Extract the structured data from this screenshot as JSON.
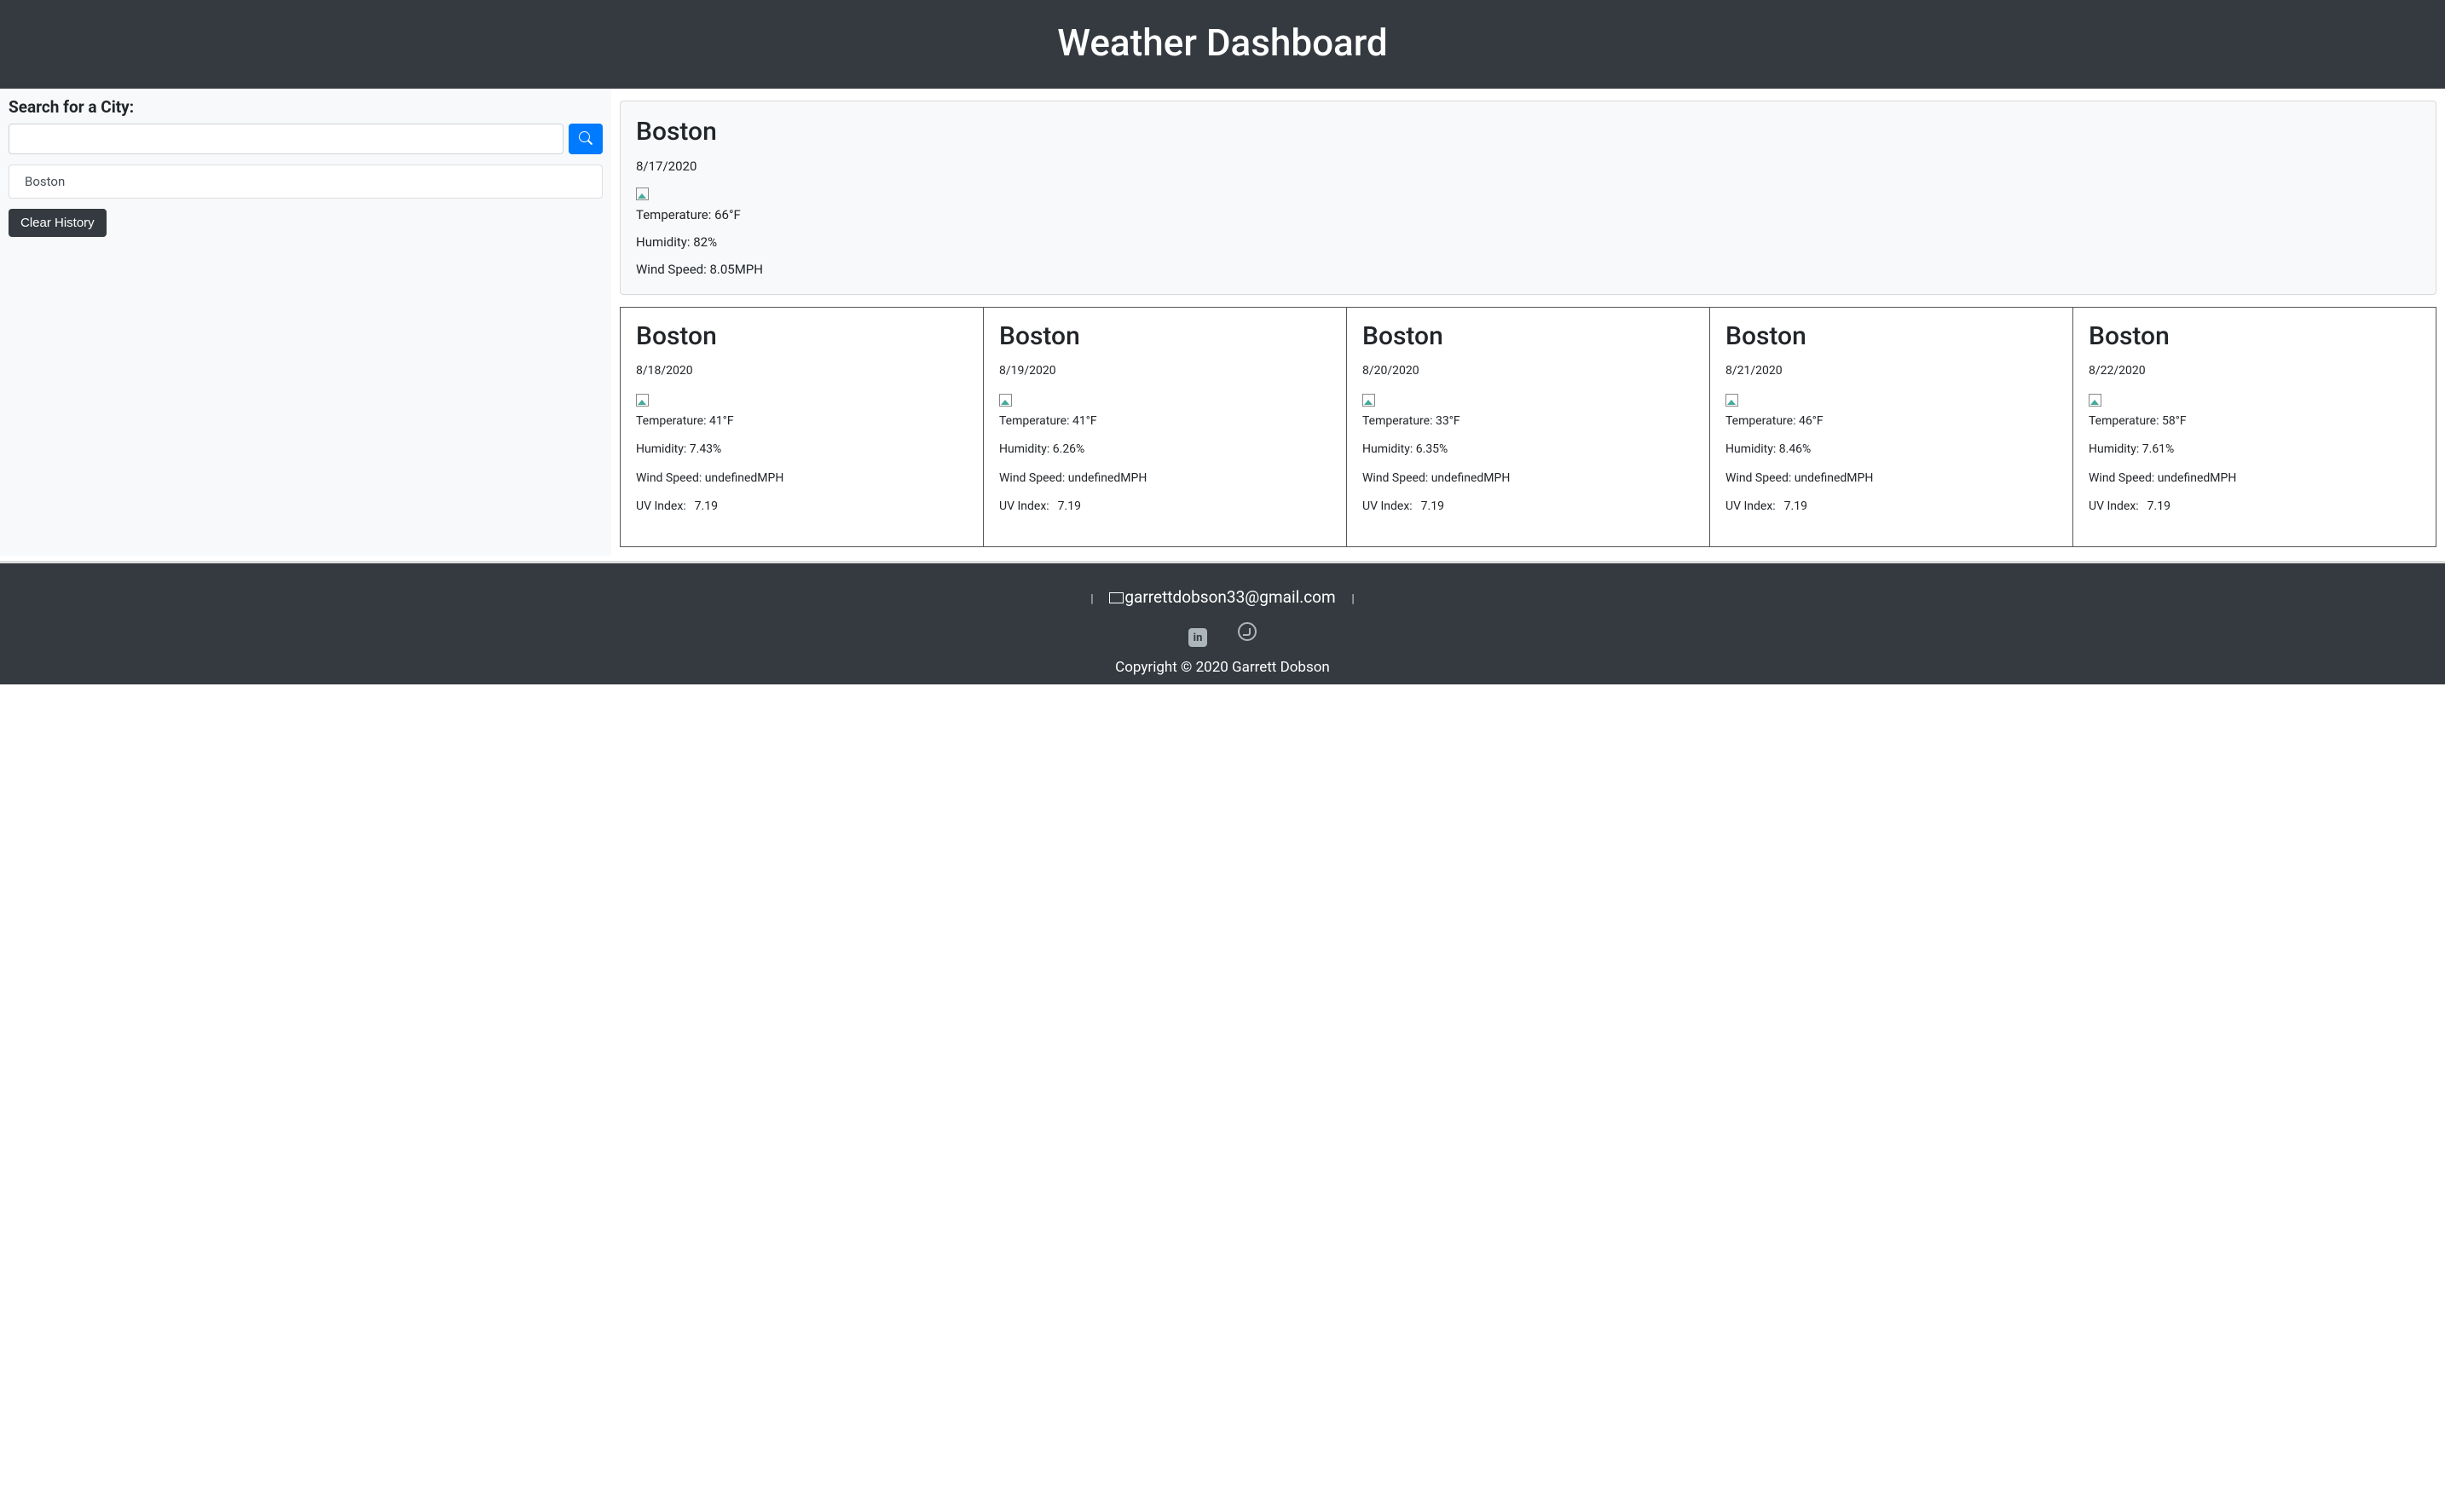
{
  "header": {
    "title": "Weather Dashboard"
  },
  "sidebar": {
    "search_label": "Search for a City:",
    "search_placeholder": "",
    "history": [
      "Boston"
    ],
    "clear_label": "Clear History"
  },
  "current": {
    "city": "Boston",
    "date": "8/17/2020",
    "temp_label": "Temperature: 66°F",
    "humidity_label": "Humidity: 82%",
    "wind_label": "Wind Speed: 8.05MPH"
  },
  "forecast": [
    {
      "city": "Boston",
      "date": "8/18/2020",
      "temp": "Temperature: 41°F",
      "humidity": "Humidity: 7.43%",
      "wind": "Wind Speed: undefinedMPH",
      "uv_label": "UV Index:",
      "uv_value": "7.19"
    },
    {
      "city": "Boston",
      "date": "8/19/2020",
      "temp": "Temperature: 41°F",
      "humidity": "Humidity: 6.26%",
      "wind": "Wind Speed: undefinedMPH",
      "uv_label": "UV Index:",
      "uv_value": "7.19"
    },
    {
      "city": "Boston",
      "date": "8/20/2020",
      "temp": "Temperature: 33°F",
      "humidity": "Humidity: 6.35%",
      "wind": "Wind Speed: undefinedMPH",
      "uv_label": "UV Index:",
      "uv_value": "7.19"
    },
    {
      "city": "Boston",
      "date": "8/21/2020",
      "temp": "Temperature: 46°F",
      "humidity": "Humidity: 8.46%",
      "wind": "Wind Speed: undefinedMPH",
      "uv_label": "UV Index:",
      "uv_value": "7.19"
    },
    {
      "city": "Boston",
      "date": "8/22/2020",
      "temp": "Temperature: 58°F",
      "humidity": "Humidity: 7.61%",
      "wind": "Wind Speed: undefinedMPH",
      "uv_label": "UV Index:",
      "uv_value": "7.19"
    }
  ],
  "footer": {
    "email": "garrettdobson33@gmail.com",
    "separator": "|",
    "copyright": "Copyright © 2020 Garrett Dobson"
  }
}
